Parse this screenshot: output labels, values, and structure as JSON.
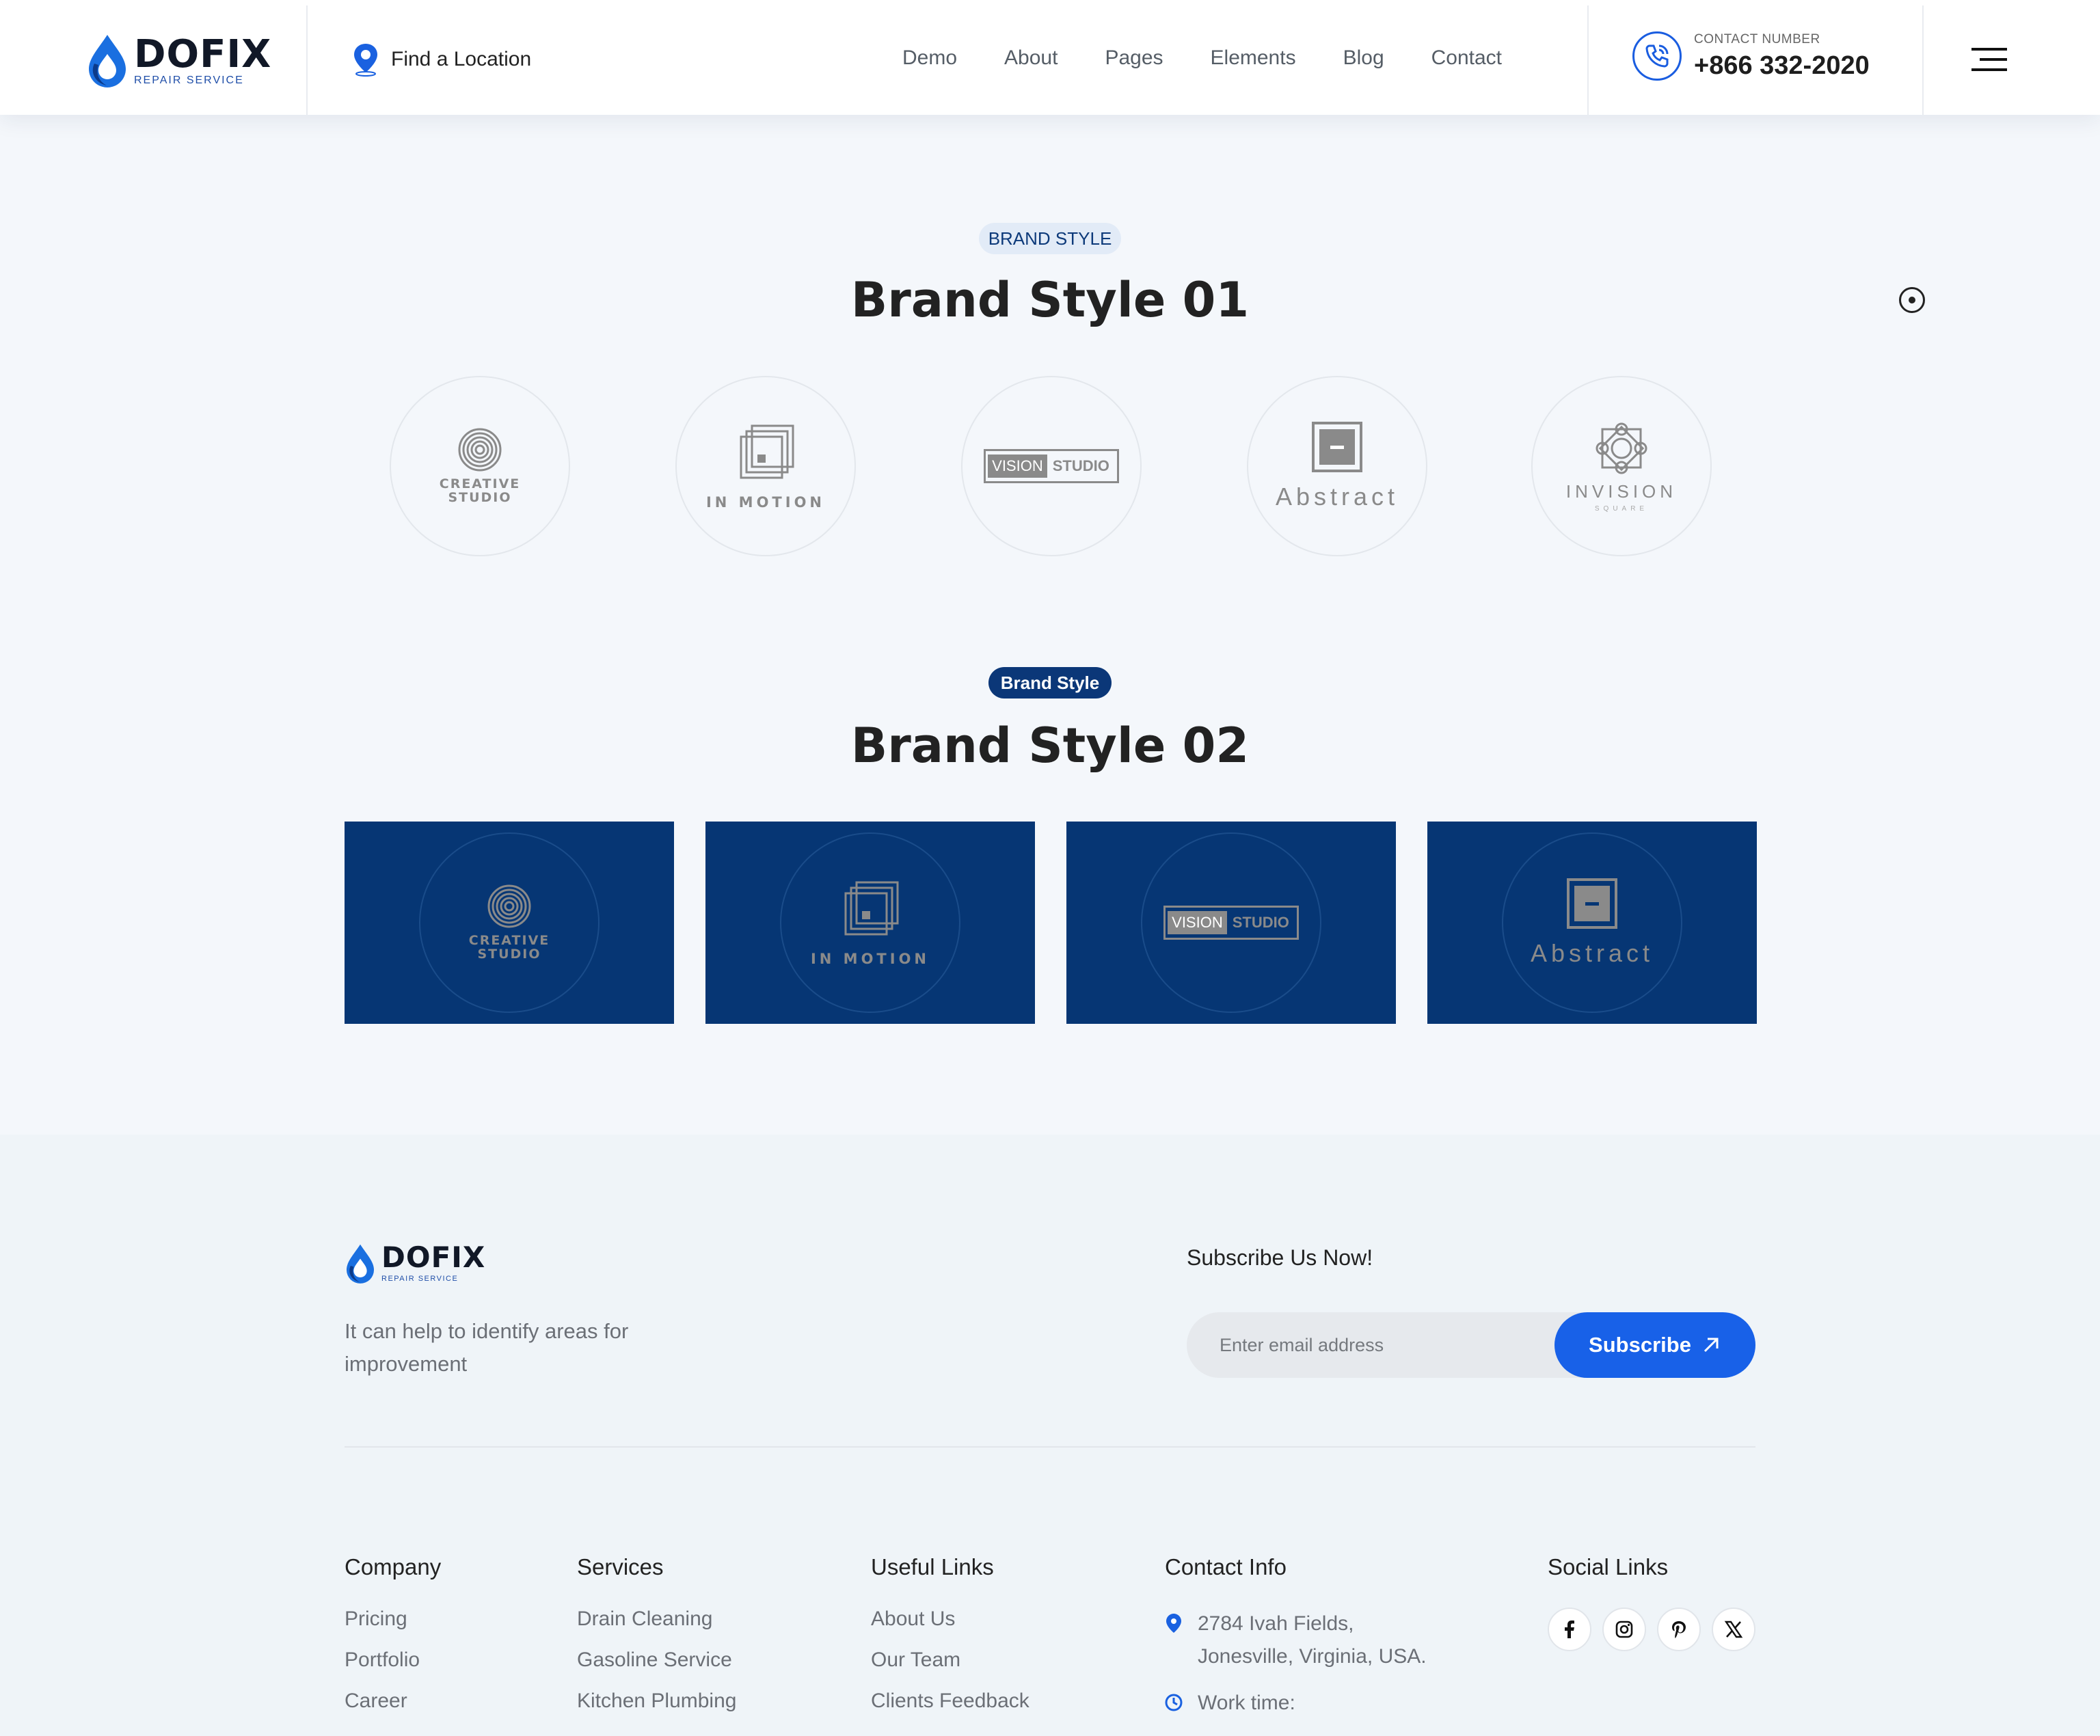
{
  "header": {
    "logo_word": "DOFIX",
    "logo_sub": "REPAIR SERVICE",
    "find_location": "Find a Location",
    "nav": [
      "Demo",
      "About",
      "Pages",
      "Elements",
      "Blog",
      "Contact"
    ],
    "contact_label": "CONTACT NUMBER",
    "contact_number": "+866 332-2020"
  },
  "brand_style_1": {
    "pill": "BRAND STYLE",
    "title": "Brand Style 01",
    "logos": {
      "creative_line1": "CREATIVE",
      "creative_line2": "STUDIO",
      "motion": "IN MOTION",
      "vision_a": "VISION",
      "vision_b": "STUDIO",
      "abstract": "Abstract",
      "invision": "INVISION",
      "invision_sub": "SQUARE"
    }
  },
  "brand_style_2": {
    "pill": "Brand Style",
    "title": "Brand Style 02"
  },
  "footer": {
    "logo_word": "DOFIX",
    "logo_sub": "REPAIR SERVICE",
    "description": "It can help to identify areas for improvement",
    "subscribe_title": "Subscribe Us Now!",
    "email_placeholder": "Enter email address",
    "subscribe_button": "Subscribe",
    "company": {
      "title": "Company",
      "links": [
        "Pricing",
        "Portfolio",
        "Career"
      ]
    },
    "services": {
      "title": "Services",
      "links": [
        "Drain Cleaning",
        "Gasoline Service",
        "Kitchen Plumbing"
      ]
    },
    "useful": {
      "title": "Useful Links",
      "links": [
        "About Us",
        "Our Team",
        "Clients Feedback"
      ]
    },
    "contact_info": {
      "title": "Contact Info",
      "address": "2784 Ivah Fields, Jonesville, Virginia, USA.",
      "work_time": "Work time:"
    },
    "social": {
      "title": "Social Links",
      "icons": [
        "facebook-icon",
        "instagram-icon",
        "pinterest-icon",
        "x-icon"
      ]
    }
  },
  "colors": {
    "brand_blue": "#1861e8",
    "navy": "#063674",
    "page_bg": "#f4f7fb"
  }
}
